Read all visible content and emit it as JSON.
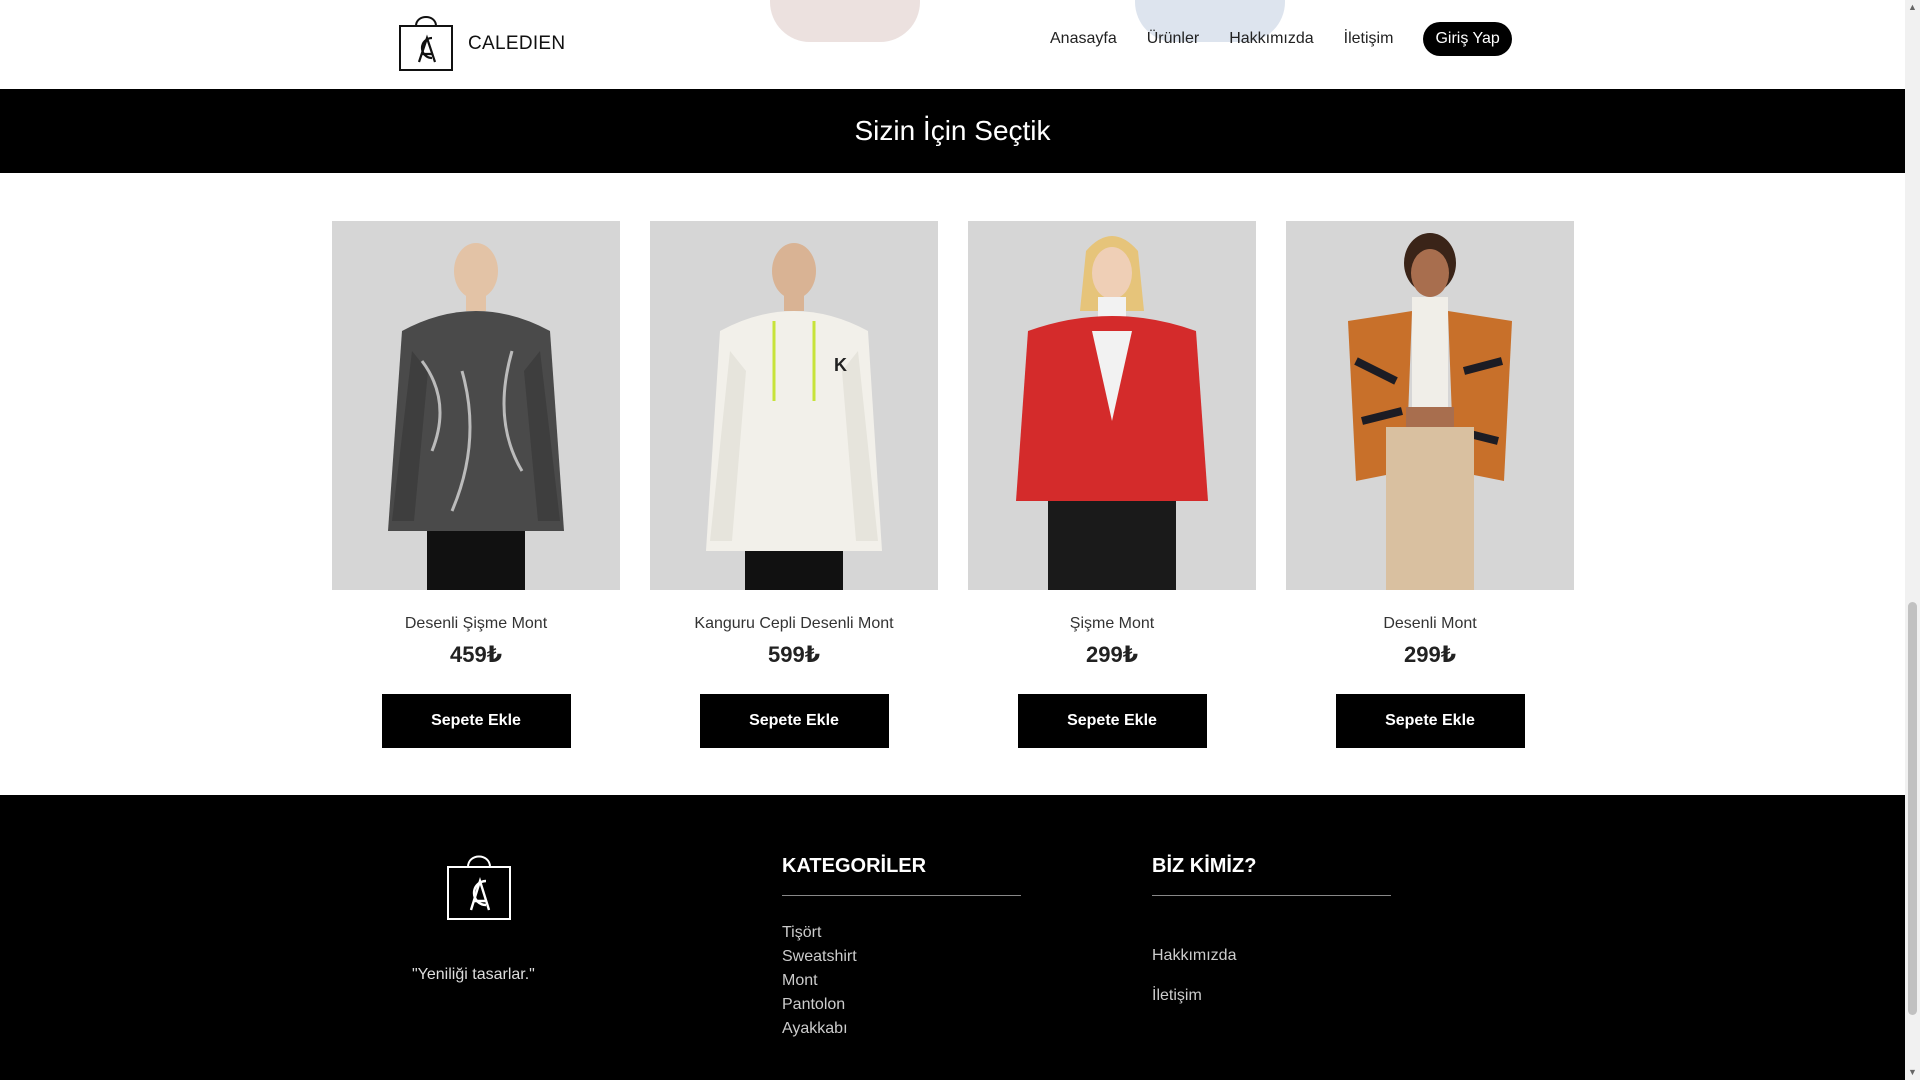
{
  "brand": {
    "name": "CALEDIEN"
  },
  "nav": {
    "items": [
      {
        "label": "Anasayfa"
      },
      {
        "label": "Ürünler"
      },
      {
        "label": "Hakkımızda"
      },
      {
        "label": "İletişim"
      }
    ],
    "login_label": "Giriş Yap"
  },
  "banner": {
    "title": "Sizin İçin Seçtik"
  },
  "products": [
    {
      "name": "Desenli Şişme Mont",
      "price": "459₺",
      "button": "Sepete Ekle",
      "jacket_color": "#4a4a4a"
    },
    {
      "name": "Kanguru Cepli Desenli Mont",
      "price": "599₺",
      "button": "Sepete Ekle",
      "jacket_color": "#f2f0ea"
    },
    {
      "name": "Şişme Mont",
      "price": "299₺",
      "button": "Sepete Ekle",
      "jacket_color": "#d42b2b"
    },
    {
      "name": "Desenli Mont",
      "price": "299₺",
      "button": "Sepete Ekle",
      "jacket_color": "#c8702a"
    }
  ],
  "footer": {
    "slogan": "\"Yeniliği tasarlar.\"",
    "categories": {
      "title": "KATEGORİLER",
      "items": [
        "Tişört",
        "Sweatshirt",
        "Mont",
        "Pantolon",
        "Ayakkabı"
      ]
    },
    "about": {
      "title": "BİZ KİMİZ?",
      "items": [
        "Hakkımızda",
        "İletişim"
      ]
    }
  },
  "colors": {
    "primary": "#000000",
    "background": "#ffffff",
    "photo_bg": "#d6d6d6"
  }
}
